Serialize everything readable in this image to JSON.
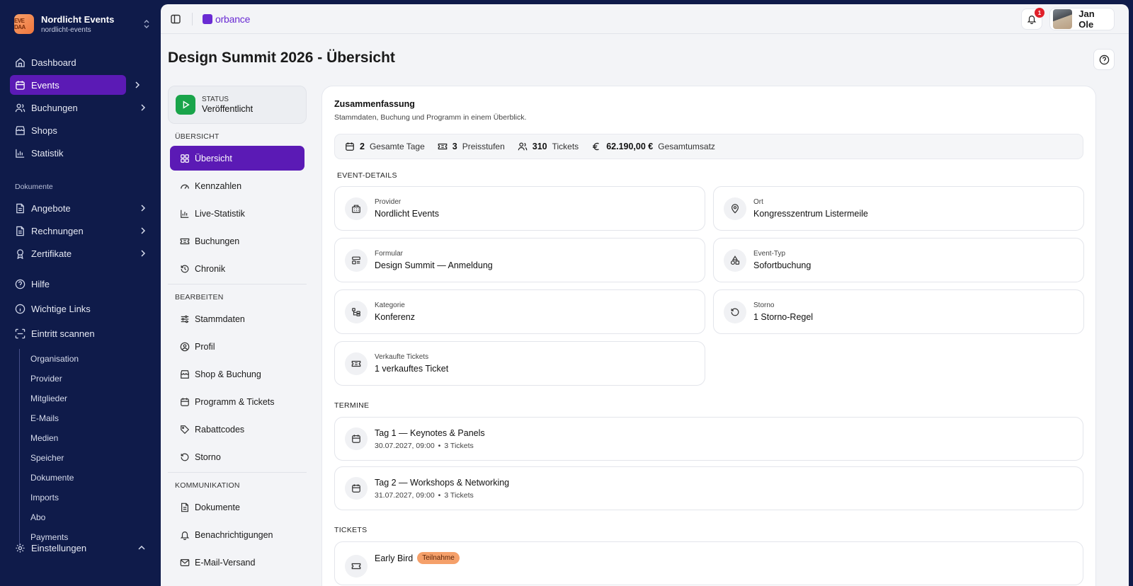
{
  "org": {
    "name": "Nordlicht Events",
    "slug": "nordlicht-events",
    "logo_text": "EVE DAA"
  },
  "sidebar": {
    "items": [
      {
        "label": "Dashboard"
      },
      {
        "label": "Events"
      },
      {
        "label": "Buchungen"
      },
      {
        "label": "Shops"
      },
      {
        "label": "Statistik"
      }
    ],
    "documents_section": "Dokumente",
    "doc_items": [
      {
        "label": "Angebote"
      },
      {
        "label": "Rechnungen"
      },
      {
        "label": "Zertifikate"
      }
    ],
    "extra_items": [
      {
        "label": "Hilfe"
      },
      {
        "label": "Wichtige Links"
      },
      {
        "label": "Eintritt scannen"
      }
    ],
    "sub_items": [
      "Organisation",
      "Provider",
      "Mitglieder",
      "E-Mails",
      "Medien",
      "Speicher",
      "Dokumente",
      "Imports",
      "Abo",
      "Payments"
    ],
    "settings_label": "Einstellungen"
  },
  "topbar": {
    "brand": "orbance",
    "notification_count": "1",
    "user_name": "Jan Ole"
  },
  "page_title": "Design Summit 2026 - Übersicht",
  "status": {
    "caption": "STATUS",
    "value": "Veröffentlicht"
  },
  "subnav": {
    "overview_section": "ÜBERSICHT",
    "overview_items": [
      "Übersicht",
      "Kennzahlen",
      "Live-Statistik",
      "Buchungen",
      "Chronik"
    ],
    "edit_section": "BEARBEITEN",
    "edit_items": [
      "Stammdaten",
      "Profil",
      "Shop & Buchung",
      "Programm & Tickets",
      "Rabattcodes",
      "Storno"
    ],
    "comm_section": "KOMMUNIKATION",
    "comm_items": [
      "Dokumente",
      "Benachrichtigungen",
      "E-Mail-Versand"
    ]
  },
  "summary": {
    "title": "Zusammenfassung",
    "subtitle": "Stammdaten, Buchung und Programm in einem Überblick.",
    "stats": [
      {
        "value": "2",
        "label": "Gesamte Tage"
      },
      {
        "value": "3",
        "label": "Preisstufen"
      },
      {
        "value": "310",
        "label": "Tickets"
      },
      {
        "value": "62.190,00 €",
        "label": "Gesamtumsatz"
      }
    ]
  },
  "event_details": {
    "label": "EVENT-DETAILS",
    "cards": [
      {
        "caption": "Provider",
        "value": "Nordlicht Events"
      },
      {
        "caption": "Ort",
        "value": "Kongresszentrum Listermeile"
      },
      {
        "caption": "Formular",
        "value": "Design Summit — Anmeldung"
      },
      {
        "caption": "Event-Typ",
        "value": "Sofortbuchung"
      },
      {
        "caption": "Kategorie",
        "value": "Konferenz"
      },
      {
        "caption": "Storno",
        "value": "1 Storno-Regel"
      },
      {
        "caption": "Verkaufte Tickets",
        "value": "1 verkauftes Ticket"
      }
    ]
  },
  "termine": {
    "label": "TERMINE",
    "items": [
      {
        "title": "Tag 1 — Keynotes & Panels",
        "date": "30.07.2027, 09:00",
        "tickets": "3 Tickets"
      },
      {
        "title": "Tag 2 — Workshops & Networking",
        "date": "31.07.2027, 09:00",
        "tickets": "3 Tickets"
      }
    ]
  },
  "tickets": {
    "label": "TICKETS",
    "items": [
      {
        "name": "Early Bird",
        "badge": "Teilnahme"
      }
    ]
  },
  "colors": {
    "sidebar_bg": "#0f1b4a",
    "accent": "#5b1ab5",
    "status_green": "#19a44a",
    "badge_orange": "#f5a06a"
  }
}
